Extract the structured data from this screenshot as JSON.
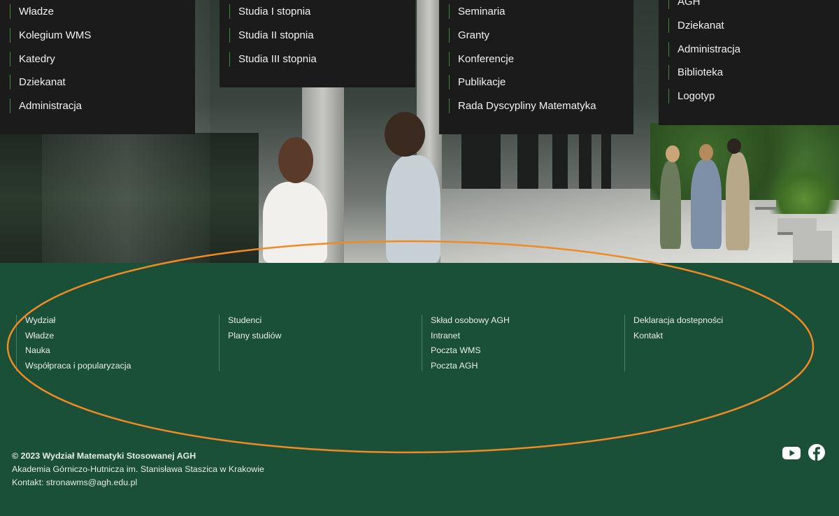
{
  "menus": [
    {
      "items": [
        "Władze",
        "Kolegium WMS",
        "Katedry",
        "Dziekanat",
        "Administracja"
      ]
    },
    {
      "items": [
        "Studia I stopnia",
        "Studia II stopnia",
        "Studia III stopnia"
      ]
    },
    {
      "items": [
        "Seminaria",
        "Granty",
        "Konferencje",
        "Publikacje",
        "Rada Dyscypliny Matematyka"
      ]
    },
    {
      "items": [
        "AGH",
        "Dziekanat",
        "Administracja",
        "Biblioteka",
        "Logotyp"
      ]
    }
  ],
  "footer": {
    "columns": [
      {
        "links": [
          "Wydział",
          "Władze",
          "Nauka",
          "Współpraca i popularyzacja"
        ]
      },
      {
        "links": [
          "Studenci",
          "Plany studiów"
        ]
      },
      {
        "links": [
          "Skład osobowy AGH",
          "Intranet",
          "Poczta WMS",
          "Poczta AGH"
        ]
      },
      {
        "links": [
          "Deklaracja dostepności",
          "Kontakt"
        ]
      }
    ],
    "copyright": "© 2023 Wydział Matematyki Stosowanej AGH",
    "university": "Akademia Górniczo-Hutnicza im. Stanisława Staszica w Krakowie",
    "contact": "Kontakt: stronawms@agh.edu.pl"
  },
  "social": {
    "icons": [
      "youtube-icon",
      "facebook-icon"
    ]
  },
  "colors": {
    "footer_bg": "#1b5038",
    "menu_bg": "#1b1b1b",
    "menu_accent": "#3d8a3c",
    "highlight_oval": "#f08a24"
  }
}
